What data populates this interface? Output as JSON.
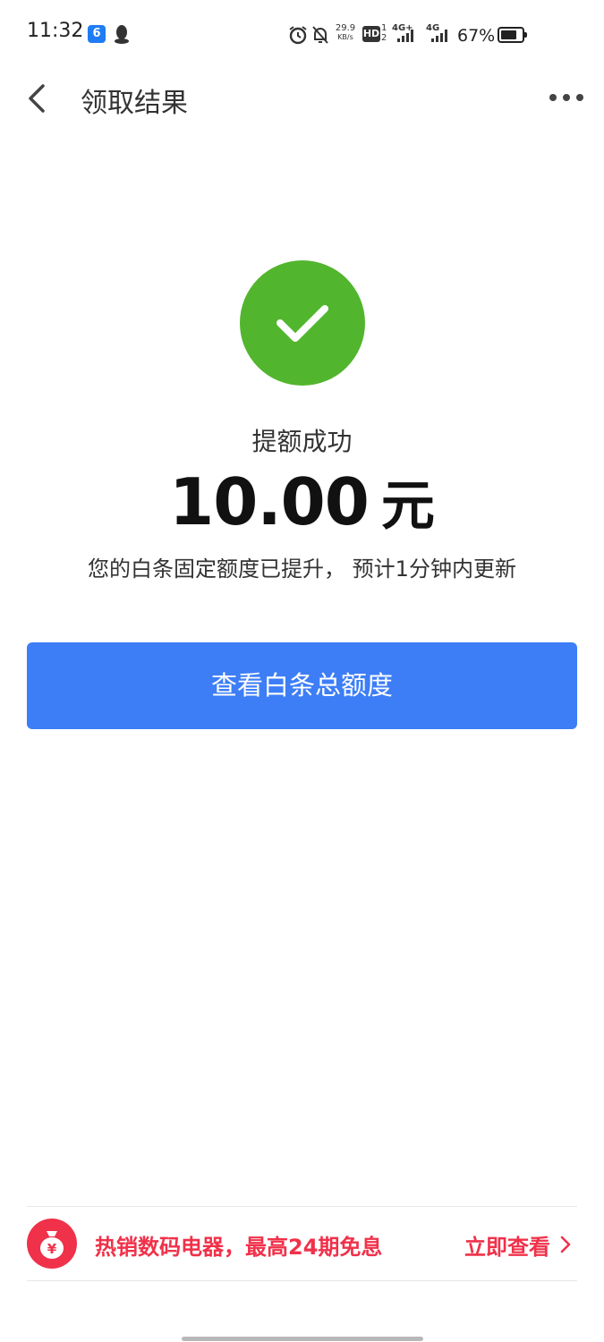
{
  "status_bar": {
    "time": "11:32",
    "app_icon_glyph": "6",
    "net_speed_value": "29.9",
    "net_speed_unit": "KB/s",
    "hd_label": "HD",
    "hd_sub_top": "1",
    "hd_sub_bottom": "2",
    "network_1": "4G+",
    "network_2": "4G",
    "battery_percent": "67%"
  },
  "nav": {
    "title": "领取结果"
  },
  "result": {
    "title": "提额成功",
    "amount": "10.00",
    "unit": "元",
    "description": "您的白条固定额度已提升， 预计1分钟内更新"
  },
  "primary_button": {
    "label": "查看白条总额度"
  },
  "promo": {
    "text": "热销数码电器，最高24期免息",
    "link": "立即查看",
    "icon_glyph": "¥"
  },
  "colors": {
    "success_green": "#52b52e",
    "primary_blue": "#3d7ef7",
    "promo_red": "#f0314a"
  }
}
